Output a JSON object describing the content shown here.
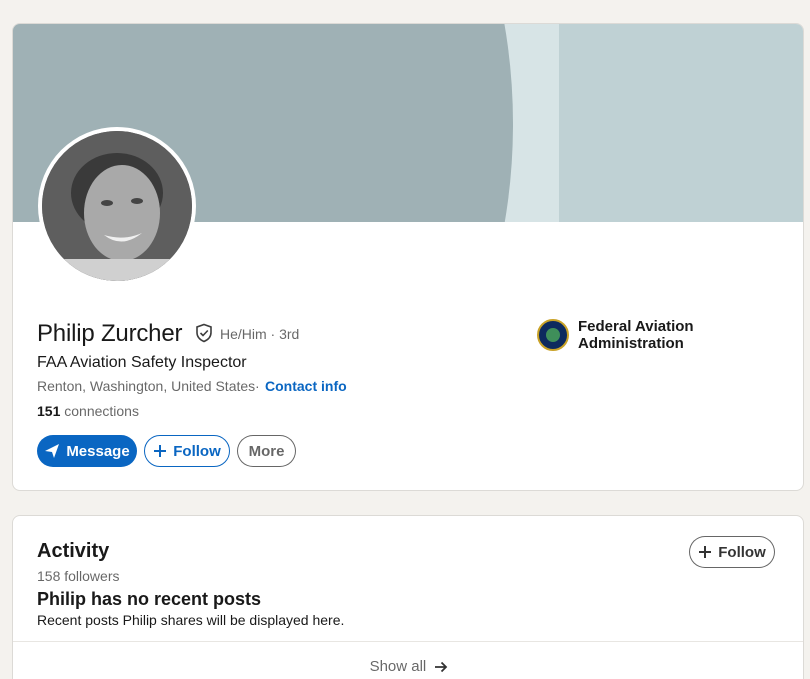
{
  "profile": {
    "name": "Philip Zurcher",
    "pronouns": "He/Him · 3rd",
    "headline": "FAA Aviation Safety Inspector",
    "location": "Renton, Washington, United States",
    "location_separator": "·",
    "contact_label": "Contact info",
    "connections_count": "151",
    "connections_label": " connections",
    "company": "Federal Aviation Administration"
  },
  "actions": {
    "message_label": "Message",
    "follow_label": "Follow",
    "more_label": "More"
  },
  "activity": {
    "title": "Activity",
    "followers": "158 followers",
    "follow_label": "Follow",
    "heading": "Philip has no recent posts",
    "description": "Recent posts Philip shares will be displayed here.",
    "show_all_label": "Show all"
  },
  "colors": {
    "accent": "#0a66c2",
    "banner_dark": "#9fb1b5",
    "banner_light": "#bfd1d4",
    "page_bg": "#f4f2ee"
  }
}
